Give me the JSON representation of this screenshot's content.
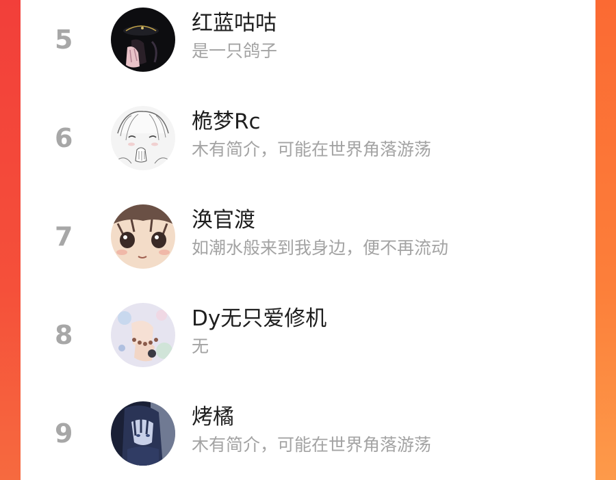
{
  "colors": {
    "background_accent": "#fa4f3f",
    "rank_number": "#a7a7a7",
    "name_text": "#1e1e1e",
    "bio_text": "#a3a3a3"
  },
  "ranking": {
    "items": [
      {
        "rank": "5",
        "name": "红蓝咕咕",
        "bio": "是一只鸽子",
        "avatar_icon": "dark-hat-figure-avatar"
      },
      {
        "rank": "6",
        "name": "桅梦Rc",
        "bio": "木有简介，可能在世界角落游荡",
        "avatar_icon": "sketch-girl-avatar"
      },
      {
        "rank": "7",
        "name": "涣官渡",
        "bio": "如潮水般来到我身边，便不再流动",
        "avatar_icon": "anime-face-closeup-avatar"
      },
      {
        "rank": "8",
        "name": "Dy无只爱修机",
        "bio": "无",
        "avatar_icon": "pastel-hands-avatar"
      },
      {
        "rank": "9",
        "name": "烤橘",
        "bio": "木有简介，可能在世界角落游荡",
        "avatar_icon": "dark-blue-girl-avatar"
      }
    ]
  }
}
